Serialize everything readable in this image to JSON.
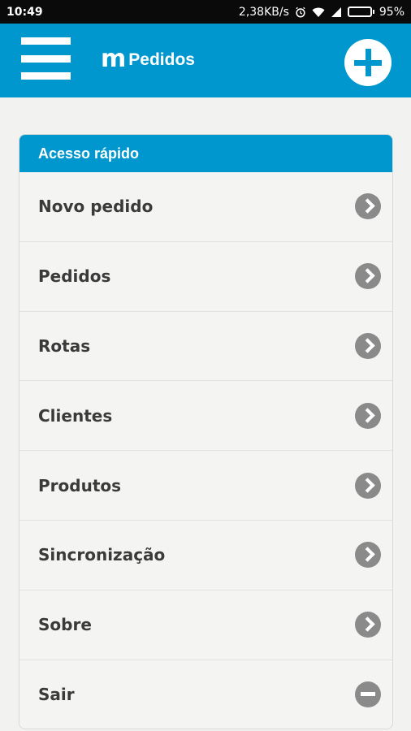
{
  "status_bar": {
    "time": "10:49",
    "speed": "2,38KB/s",
    "battery": "95%",
    "battery_level": 0.95
  },
  "app_bar": {
    "logo": "m",
    "title": "Pedidos",
    "menu_icon": "hamburger-menu-icon",
    "add_icon": "plus-circle-icon"
  },
  "quick_access": {
    "header": "Acesso rápido",
    "items": [
      {
        "label": "Novo pedido",
        "icon": "chevron-right-icon"
      },
      {
        "label": "Pedidos",
        "icon": "chevron-right-icon"
      },
      {
        "label": "Rotas",
        "icon": "chevron-right-icon"
      },
      {
        "label": "Clientes",
        "icon": "chevron-right-icon"
      },
      {
        "label": "Produtos",
        "icon": "chevron-right-icon"
      },
      {
        "label": "Sincronização",
        "icon": "chevron-right-icon"
      },
      {
        "label": "Sobre",
        "icon": "chevron-right-icon"
      },
      {
        "label": "Sair",
        "icon": "minus-circle-icon"
      }
    ]
  },
  "colors": {
    "primary": "#0097cf",
    "icon_gray": "#8a8a8a",
    "background": "#f2f2f0"
  }
}
